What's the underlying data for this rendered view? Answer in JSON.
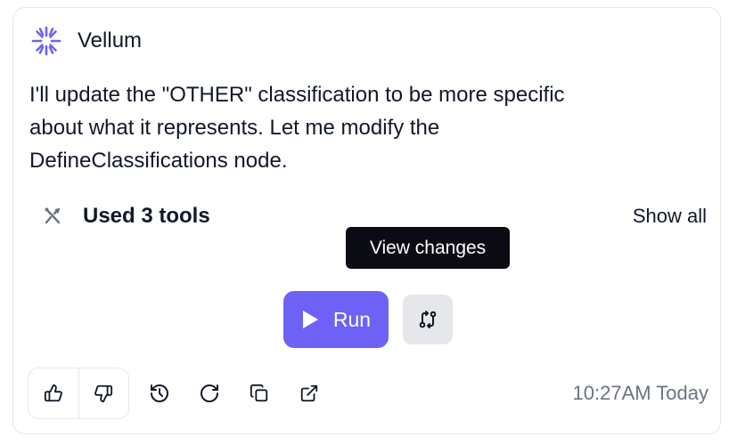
{
  "header": {
    "brand": "Vellum",
    "logo_icon": "vellum-logo-icon"
  },
  "message": {
    "lines": [
      "I'll update the \"OTHER\" classification to be more specific",
      "about what it represents. Let me modify the",
      "DefineClassifications node."
    ]
  },
  "tools": {
    "icon": "tools-icon",
    "label": "Used 3 tools",
    "show_all": "Show all"
  },
  "tooltip": {
    "text": "View changes"
  },
  "actions": {
    "run_label": "Run",
    "changes_icon": "git-compare-icon"
  },
  "footer": {
    "timestamp": "10:27AM Today",
    "icons": [
      "thumbs-up-icon",
      "thumbs-down-icon",
      "history-icon",
      "refresh-icon",
      "copy-icon",
      "external-link-icon"
    ]
  },
  "colors": {
    "accent": "#6d62f5",
    "tooltip_bg": "#0b0b14",
    "muted_text": "#6b7280",
    "border": "#e5e7eb"
  }
}
